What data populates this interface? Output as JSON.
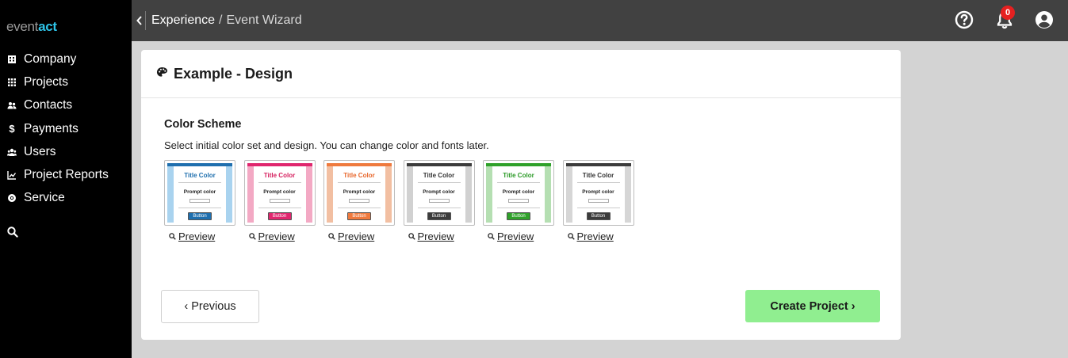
{
  "logo": {
    "part1": "event",
    "part2": "act"
  },
  "sidebar": {
    "items": [
      {
        "label": "Company",
        "icon": "building-icon"
      },
      {
        "label": "Projects",
        "icon": "grid-icon"
      },
      {
        "label": "Contacts",
        "icon": "people-icon"
      },
      {
        "label": "Payments",
        "icon": "dollar-icon"
      },
      {
        "label": "Users",
        "icon": "users-icon"
      },
      {
        "label": "Project Reports",
        "icon": "chart-line-icon"
      },
      {
        "label": "Service",
        "icon": "support-icon"
      }
    ],
    "search_icon": "search-icon"
  },
  "topbar": {
    "breadcrumb_root": "Experience",
    "breadcrumb_sep": "/",
    "breadcrumb_current": "Event Wizard",
    "notification_count": "0"
  },
  "card": {
    "title": "Example - Design",
    "section_title": "Color Scheme",
    "section_desc": "Select initial color set and design. You can change color and fonts later.",
    "schemes": [
      {
        "title": "Title Color",
        "prompt": "Prompt color",
        "button": "Button",
        "preview": "Preview",
        "accent": "#1f6fae",
        "border": "#a9d3ef",
        "title_color": "#1f6fae"
      },
      {
        "title": "Title Color",
        "prompt": "Prompt color",
        "button": "Button",
        "preview": "Preview",
        "accent": "#e0266e",
        "border": "#f3a9c4",
        "title_color": "#d61f5e"
      },
      {
        "title": "Title Color",
        "prompt": "Prompt color",
        "button": "Button",
        "preview": "Preview",
        "accent": "#ef7a3e",
        "border": "#f2bfa2",
        "title_color": "#e8672c"
      },
      {
        "title": "Title Color",
        "prompt": "Prompt color",
        "button": "Button",
        "preview": "Preview",
        "accent": "#3c3c3c",
        "border": "#d1d1d1",
        "title_color": "#333333"
      },
      {
        "title": "Title Color",
        "prompt": "Prompt color",
        "button": "Button",
        "preview": "Preview",
        "accent": "#2fa12a",
        "border": "#b5dfb2",
        "title_color": "#2b9a26"
      },
      {
        "title": "Title Color",
        "prompt": "Prompt color",
        "button": "Button",
        "preview": "Preview",
        "accent": "#3c3c3c",
        "border": "#d6d6d6",
        "title_color": "#333333"
      }
    ],
    "prev_label": "‹ Previous",
    "create_label": "Create Project ›"
  }
}
